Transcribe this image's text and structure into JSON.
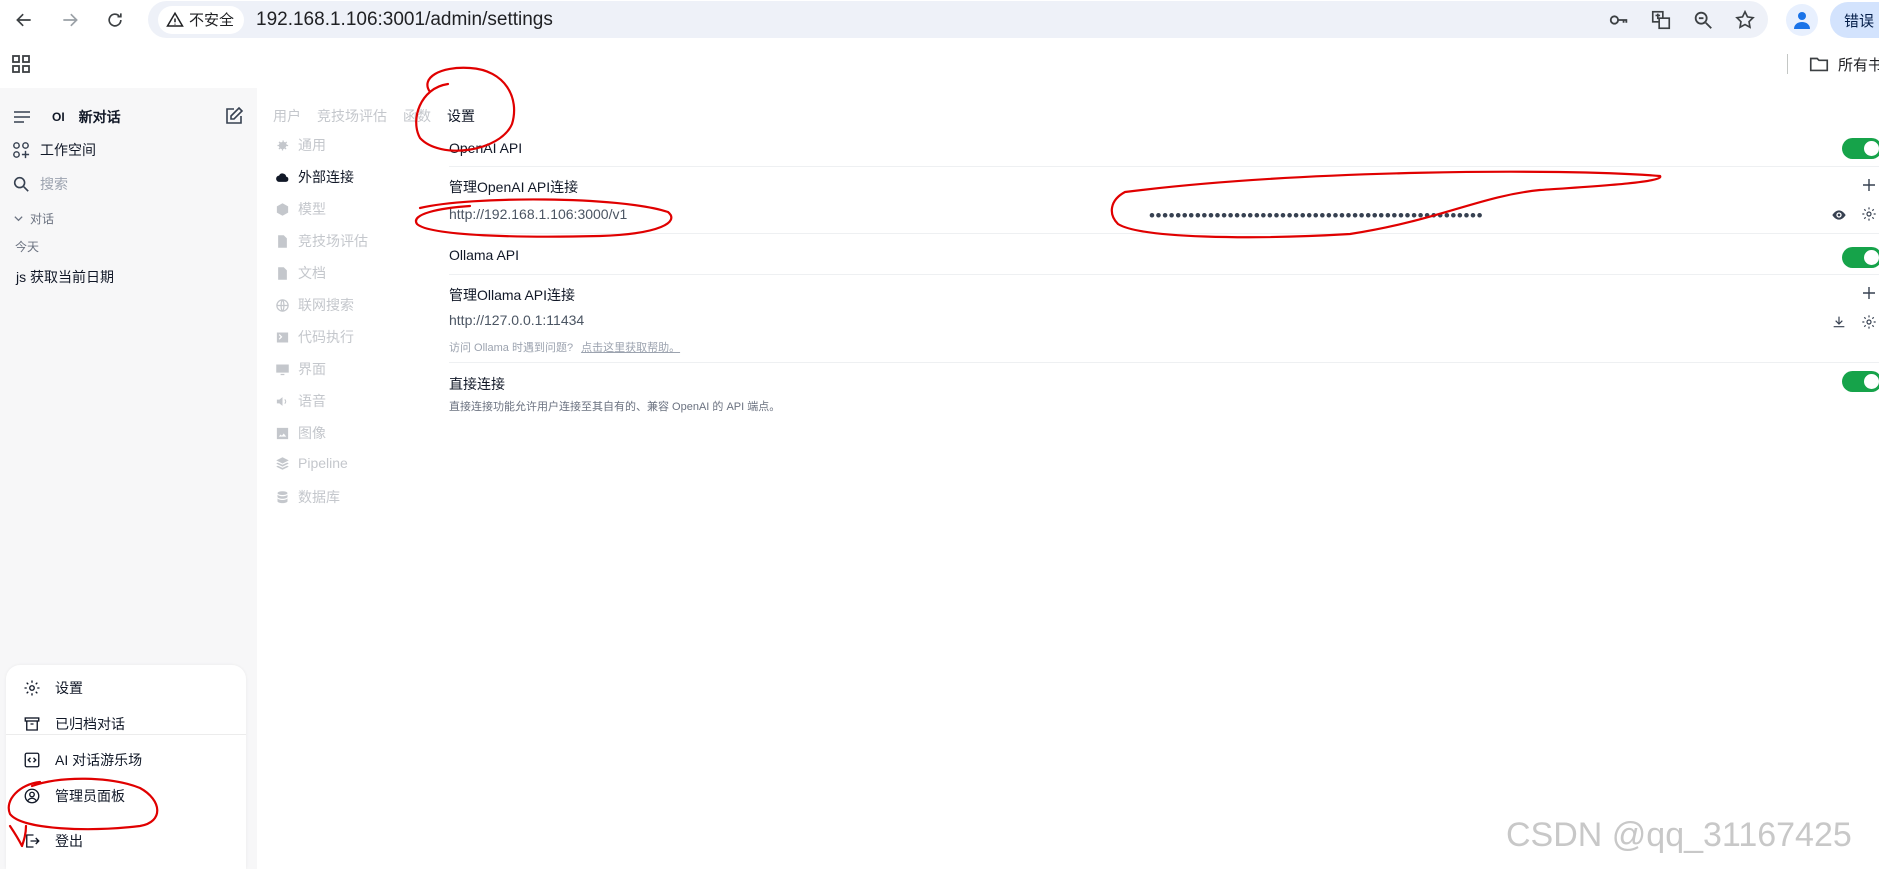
{
  "browser": {
    "security_label": "不安全",
    "url": "192.168.1.106:3001/admin/settings",
    "error_pill": "错误",
    "bookmark_folder": "所有书"
  },
  "sidebar": {
    "logo": "OI",
    "new_chat": "新对话",
    "workspace": "工作空间",
    "search_placeholder": "搜索",
    "section_label": "对话",
    "group_today": "今天",
    "chat_item": "js 获取当前日期"
  },
  "user_menu": {
    "items": [
      {
        "label": "设置",
        "icon": "gear-icon"
      },
      {
        "label": "已归档对话",
        "icon": "archive-icon"
      },
      {
        "label": "AI 对话游乐场",
        "icon": "code-icon"
      },
      {
        "label": "管理员面板",
        "icon": "user-circle-icon"
      },
      {
        "label": "登出",
        "icon": "logout-icon"
      }
    ]
  },
  "admin_tabs": [
    "用户",
    "竞技场评估",
    "函数",
    "设置"
  ],
  "admin_active_tab": "设置",
  "settings_tabs": [
    {
      "label": "通用",
      "icon": "gear-icon"
    },
    {
      "label": "外部连接",
      "icon": "cloud-icon",
      "active": true
    },
    {
      "label": "模型",
      "icon": "cube-icon"
    },
    {
      "label": "竞技场评估",
      "icon": "document-icon"
    },
    {
      "label": "文档",
      "icon": "document-icon"
    },
    {
      "label": "联网搜索",
      "icon": "globe-icon"
    },
    {
      "label": "代码执行",
      "icon": "terminal-icon"
    },
    {
      "label": "界面",
      "icon": "monitor-icon"
    },
    {
      "label": "语音",
      "icon": "speaker-icon"
    },
    {
      "label": "图像",
      "icon": "image-icon"
    },
    {
      "label": "Pipeline",
      "icon": "layers-icon"
    },
    {
      "label": "数据库",
      "icon": "database-icon"
    }
  ],
  "connections": {
    "openai_title": "OpenAI API",
    "openai_enabled": true,
    "openai_manage": "管理OpenAI API连接",
    "openai_url": "http://192.168.1.106:3000/v1",
    "openai_key_masked": "•••••••••••••••••••••••••••••••••••••••••••••••••••",
    "ollama_title": "Ollama API",
    "ollama_enabled": true,
    "ollama_manage": "管理Ollama API连接",
    "ollama_url": "http://127.0.0.1:11434",
    "ollama_hint": "访问 Ollama 时遇到问题?",
    "ollama_hint_link": "点击这里获取帮助。",
    "direct_title": "直接连接",
    "direct_enabled": true,
    "direct_desc": "直接连接功能允许用户连接至其自有的、兼容 OpenAI 的 API 端点。"
  },
  "watermark": "CSDN @qq_31167425",
  "colors": {
    "toggle_on": "#16a34a",
    "annotation": "#e00000",
    "sidebar_bg": "#f7f7f8"
  }
}
